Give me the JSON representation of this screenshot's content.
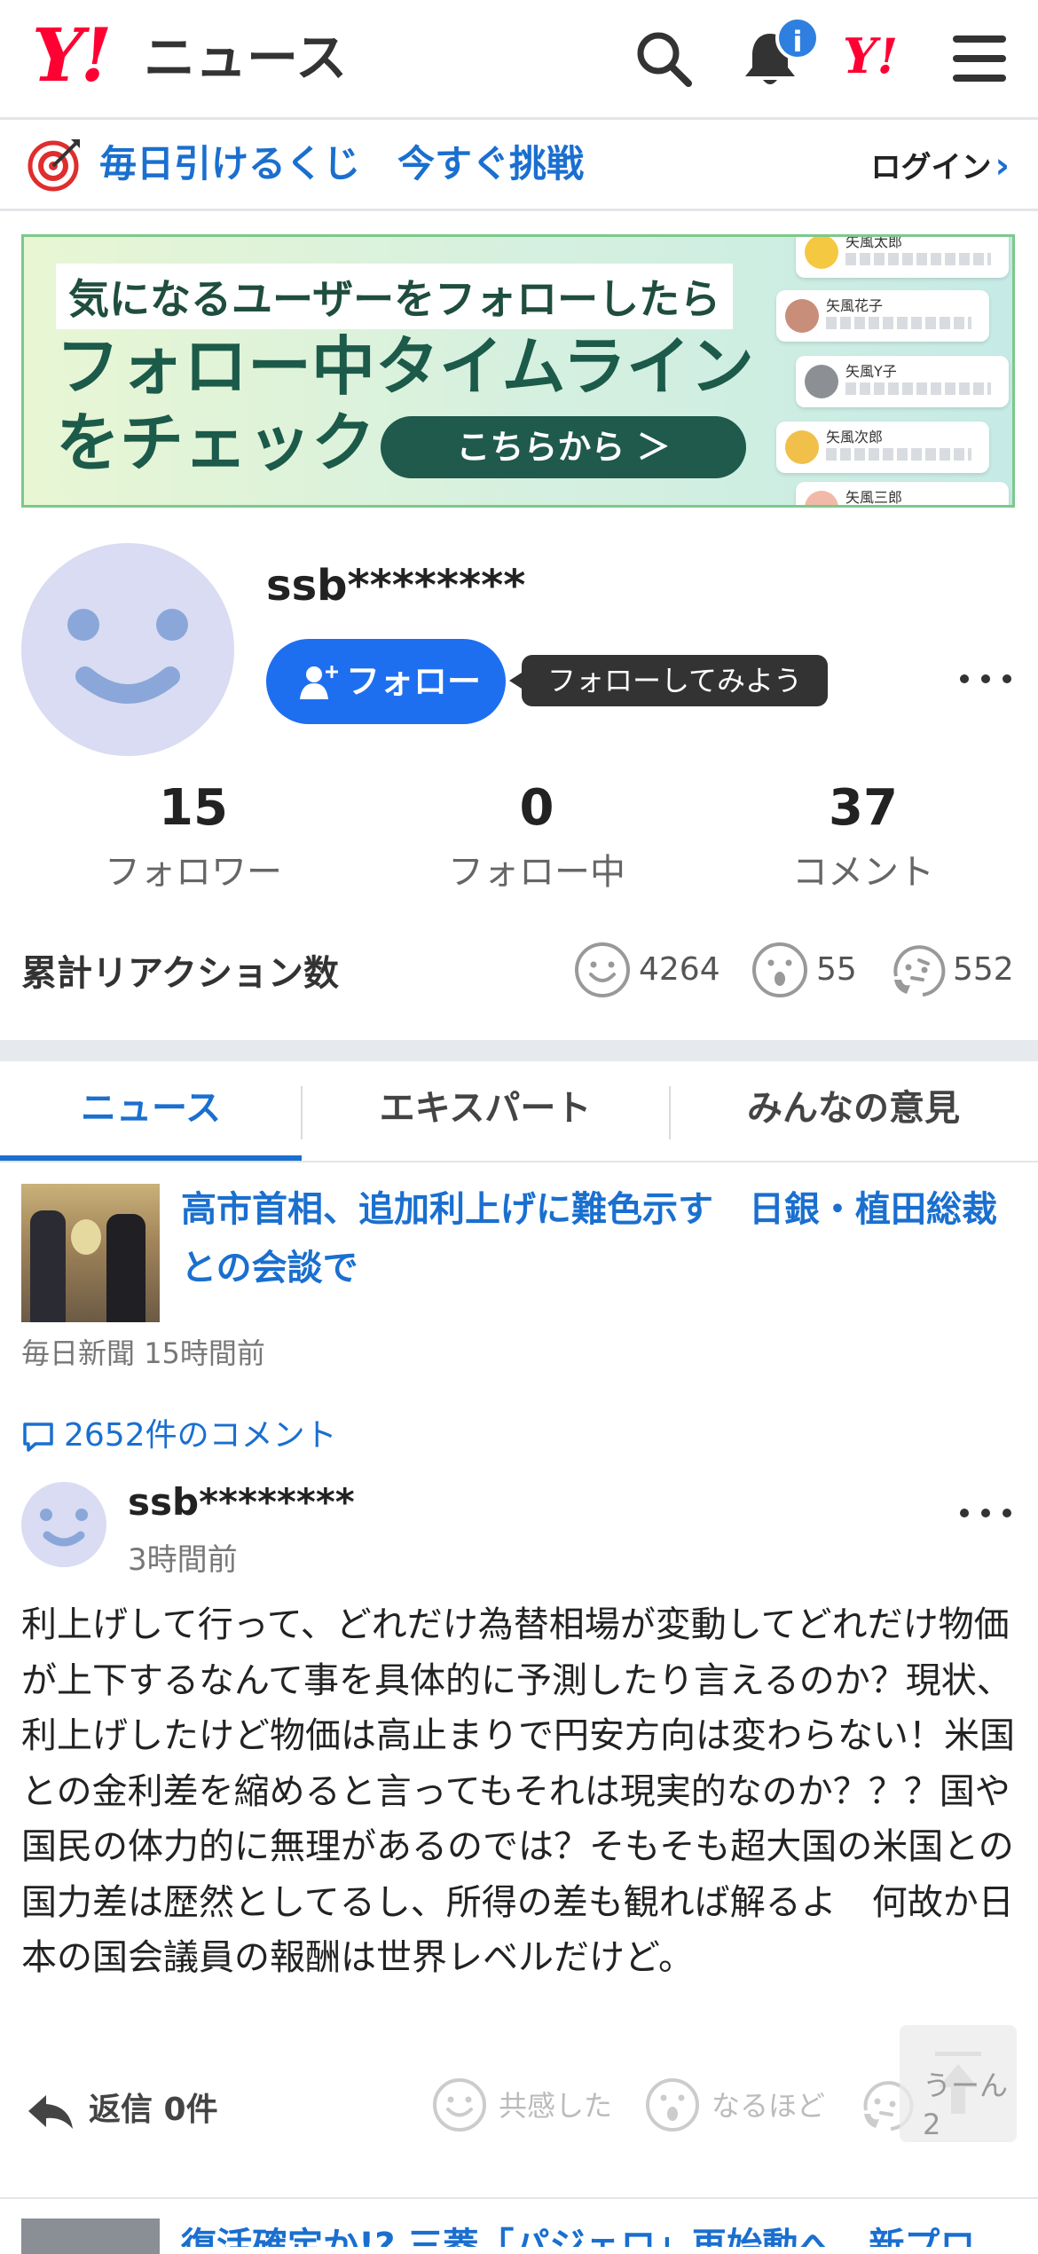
{
  "header": {
    "logo_mark": "Y!",
    "logo_text": "ニュース",
    "notification_badge": "i",
    "yahoo_mark": "Y!",
    "icons": [
      "search-icon",
      "bell-icon",
      "yahoo-icon",
      "hamburger-menu-icon"
    ]
  },
  "promo": {
    "text": "毎日引けるくじ　今すぐ挑戦",
    "login": "ログイン"
  },
  "banner": {
    "line1": "気になるユーザーをフォローしたら",
    "line2": "フォロー中タイムライン",
    "line3": "をチェック",
    "button": "こちらから ＞",
    "users": [
      "矢風太郎",
      "矢風花子",
      "矢風Y子",
      "矢風次郎",
      "矢風三郎"
    ]
  },
  "profile": {
    "username": "ssb********",
    "follow_button": "フォロー",
    "tooltip": "フォローしてみよう"
  },
  "stats": {
    "followers": {
      "value": "15",
      "label": "フォロワー"
    },
    "following": {
      "value": "0",
      "label": "フォロー中"
    },
    "comments": {
      "value": "37",
      "label": "コメント"
    }
  },
  "reactions": {
    "label": "累計リアクション数",
    "empathy": "4264",
    "insight": "55",
    "hmm": "552"
  },
  "tabs": [
    "ニュース",
    "エキスパート",
    "みんなの意見"
  ],
  "article": {
    "title": "高市首相、追加利上げに難色示す　日銀・植田総裁との会談で",
    "source": "毎日新聞",
    "time": "15時間前",
    "comment_count": "2652件のコメント"
  },
  "comment": {
    "user": "ssb********",
    "time": "3時間前",
    "body": "利上げして行って、どれだけ為替相場が変動してどれだけ物価が上下するなんて事を具体的に予測したり言えるのか？現状、利上げしたけど物価は高止まりで円安方向は変わらない！米国との金利差を縮めると言ってもそれは現実的なのか？？？国や国民の体力的に無理があるのでは？そもそも超大国の米国との国力差は歴然としてるし、所得の差も観れば解るよ　何故か日本の国会議員の報酬は世界レベルだけど。",
    "reply": "返信 0件",
    "react_empathy": "共感した",
    "react_insight": "なるほど",
    "react_hmm": "うーん",
    "react_hmm_count": "2"
  },
  "next_article": {
    "title": "復活確定か!? 三菱「パジェロ」再始動へ　新プロ"
  },
  "colors": {
    "brand_red": "#ff0033",
    "link_blue": "#1a6fcf",
    "follow_blue": "#1e6ff0",
    "banner_green": "#1f5a4c"
  }
}
